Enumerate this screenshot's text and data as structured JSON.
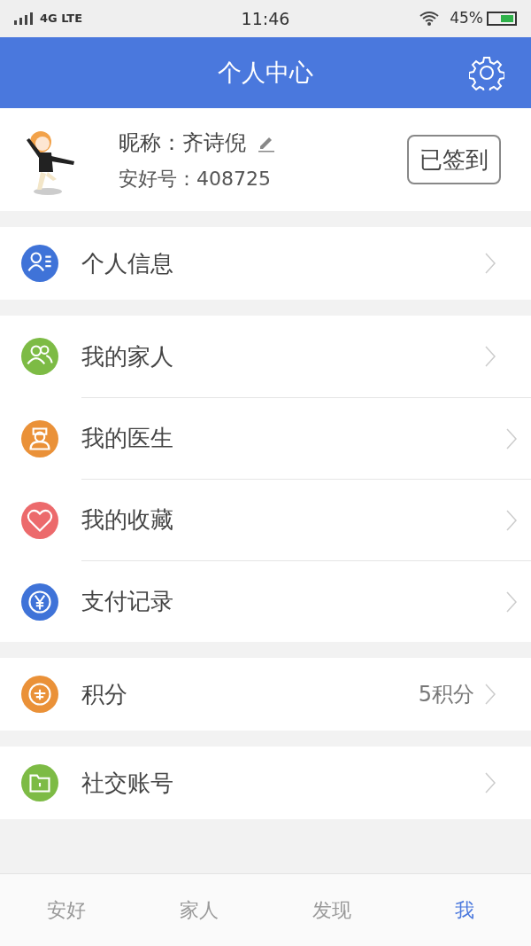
{
  "status_bar": {
    "network": "4G LTE",
    "time": "11:46",
    "battery_percent": "45%"
  },
  "header": {
    "title": "个人中心"
  },
  "profile": {
    "nickname_label": "昵称：",
    "nickname": "齐诗倪",
    "id_label": "安好号：",
    "id": "408725",
    "checkin_button": "已签到"
  },
  "groups": [
    [
      {
        "kind": "profile",
        "label": "个人信息",
        "color": "#3f73d8"
      }
    ],
    [
      {
        "kind": "family",
        "label": "我的家人",
        "color": "#7dbb45"
      },
      {
        "kind": "doctor",
        "label": "我的医生",
        "color": "#ea9138"
      },
      {
        "kind": "favorite",
        "label": "我的收藏",
        "color": "#ec6a6c"
      },
      {
        "kind": "payment",
        "label": "支付记录",
        "color": "#3f73d8"
      }
    ],
    [
      {
        "kind": "points",
        "label": "积分",
        "value": "5积分",
        "color": "#ea9138"
      }
    ],
    [
      {
        "kind": "social",
        "label": "社交账号",
        "color": "#7dbb45"
      }
    ]
  ],
  "tabs": [
    {
      "label": "安好",
      "selected": false
    },
    {
      "label": "家人",
      "selected": false
    },
    {
      "label": "发现",
      "selected": false
    },
    {
      "label": "我",
      "selected": true
    }
  ]
}
